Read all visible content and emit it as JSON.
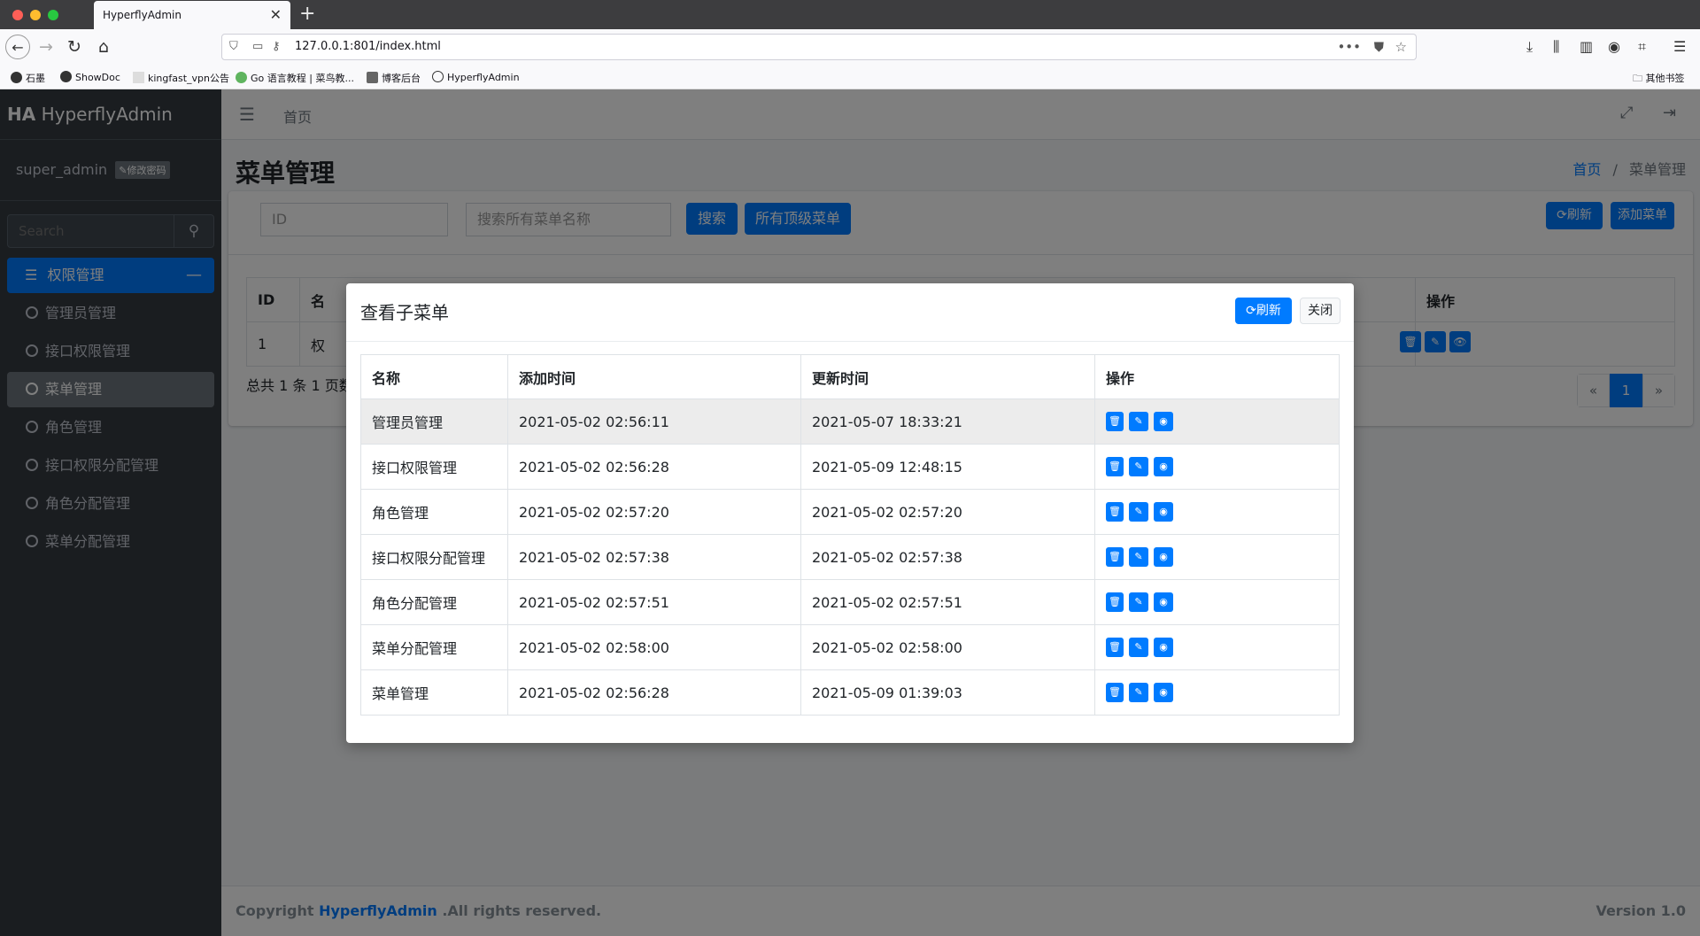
{
  "browser": {
    "tab_title": "HyperflyAdmin",
    "url": "127.0.0.1:801/index.html",
    "bookmarks": [
      "石墨",
      "ShowDoc",
      "kingfast_vpn公告",
      "Go 语言教程 | 菜鸟教...",
      "博客后台",
      "HyperflyAdmin"
    ],
    "other_bookmarks": "其他书签"
  },
  "sidebar": {
    "brand_short": "HA",
    "brand_name": "HyperflyAdmin",
    "username": "super_admin",
    "change_password": "修改密码",
    "search_placeholder": "Search",
    "parent_item": "权限管理",
    "items": [
      "管理员管理",
      "接口权限管理",
      "菜单管理",
      "角色管理",
      "接口权限分配管理",
      "角色分配管理",
      "菜单分配管理"
    ]
  },
  "header": {
    "home": "首页"
  },
  "page": {
    "title": "菜单管理",
    "breadcrumb_home": "首页",
    "breadcrumb_sep": "/",
    "breadcrumb_current": "菜单管理",
    "id_placeholder": "ID",
    "name_placeholder": "搜索所有菜单名称",
    "search_btn": "搜索",
    "top_menus_btn": "所有顶级菜单",
    "refresh_btn": "刷新",
    "add_btn": "添加菜单",
    "table_col_id": "ID",
    "table_col_name": "名",
    "table_col_ops": "操作",
    "row_id": "1",
    "row_name": "权",
    "total_text": "总共 1 条 1 页数",
    "pager_prev": "«",
    "pager_current": "1",
    "pager_next": "»"
  },
  "footer": {
    "copyright_prefix": "Copyright ",
    "copyright_link": "HyperflyAdmin",
    "copyright_suffix": " .All rights reserved.",
    "version": "Version 1.0"
  },
  "modal": {
    "title": "查看子菜单",
    "refresh": "刷新",
    "close": "关闭",
    "columns": [
      "名称",
      "添加时间",
      "更新时间",
      "操作"
    ],
    "rows": [
      {
        "name": "管理员管理",
        "created": "2021-05-02 02:56:11",
        "updated": "2021-05-07 18:33:21"
      },
      {
        "name": "接口权限管理",
        "created": "2021-05-02 02:56:28",
        "updated": "2021-05-09 12:48:15"
      },
      {
        "name": "角色管理",
        "created": "2021-05-02 02:57:20",
        "updated": "2021-05-02 02:57:20"
      },
      {
        "name": "接口权限分配管理",
        "created": "2021-05-02 02:57:38",
        "updated": "2021-05-02 02:57:38"
      },
      {
        "name": "角色分配管理",
        "created": "2021-05-02 02:57:51",
        "updated": "2021-05-02 02:57:51"
      },
      {
        "name": "菜单分配管理",
        "created": "2021-05-02 02:58:00",
        "updated": "2021-05-02 02:58:00"
      },
      {
        "name": "菜单管理",
        "created": "2021-05-02 02:56:28",
        "updated": "2021-05-09 01:39:03"
      }
    ]
  },
  "colors": {
    "primary": "#007bff",
    "sidebar_bg": "#343a40",
    "active_item": "#6c757d"
  }
}
